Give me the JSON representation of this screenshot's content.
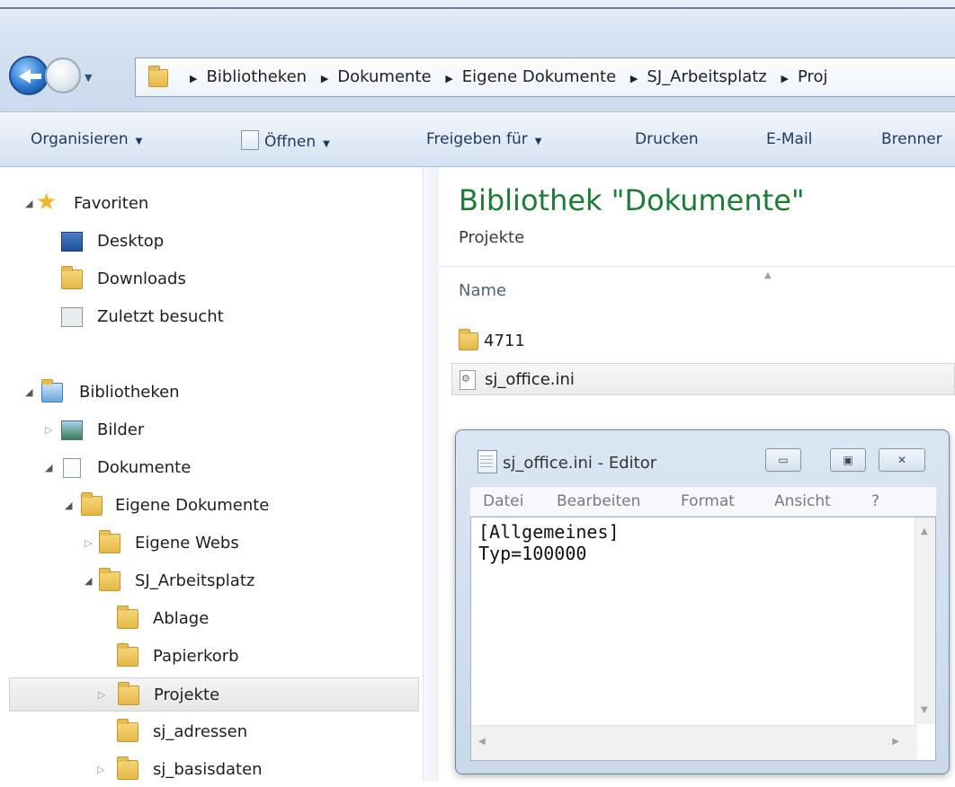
{
  "address": {
    "crumbs": [
      "Bibliotheken",
      "Dokumente",
      "Eigene Dokumente",
      "SJ_Arbeitsplatz",
      "Proj"
    ]
  },
  "toolbar": {
    "organize": "Organisieren",
    "open": "Öffnen",
    "share": "Freigeben für",
    "print": "Drucken",
    "email": "E-Mail",
    "burn": "Brenner"
  },
  "nav": {
    "favorites": "Favoriten",
    "desktop": "Desktop",
    "downloads": "Downloads",
    "recent": "Zuletzt besucht",
    "libraries": "Bibliotheken",
    "pictures": "Bilder",
    "documents": "Dokumente",
    "my_documents": "Eigene Dokumente",
    "my_webs": "Eigene Webs",
    "workspace": "SJ_Arbeitsplatz",
    "ablage": "Ablage",
    "papierkorb": "Papierkorb",
    "projekte": "Projekte",
    "adressen": "sj_adressen",
    "basisdaten": "sj_basisdaten"
  },
  "content": {
    "title": "Bibliothek \"Dokumente\"",
    "subtitle": "Projekte",
    "column_name": "Name",
    "files": [
      "4711",
      "sj_office.ini"
    ]
  },
  "editor": {
    "title": "sj_office.ini - Editor",
    "menu": [
      "Datei",
      "Bearbeiten",
      "Format",
      "Ansicht",
      "?"
    ],
    "lines": [
      "[Allgemeines]",
      "Typ=100000"
    ],
    "buttons": {
      "minimize": "▭",
      "maximize": "▣",
      "close": "✕"
    }
  }
}
